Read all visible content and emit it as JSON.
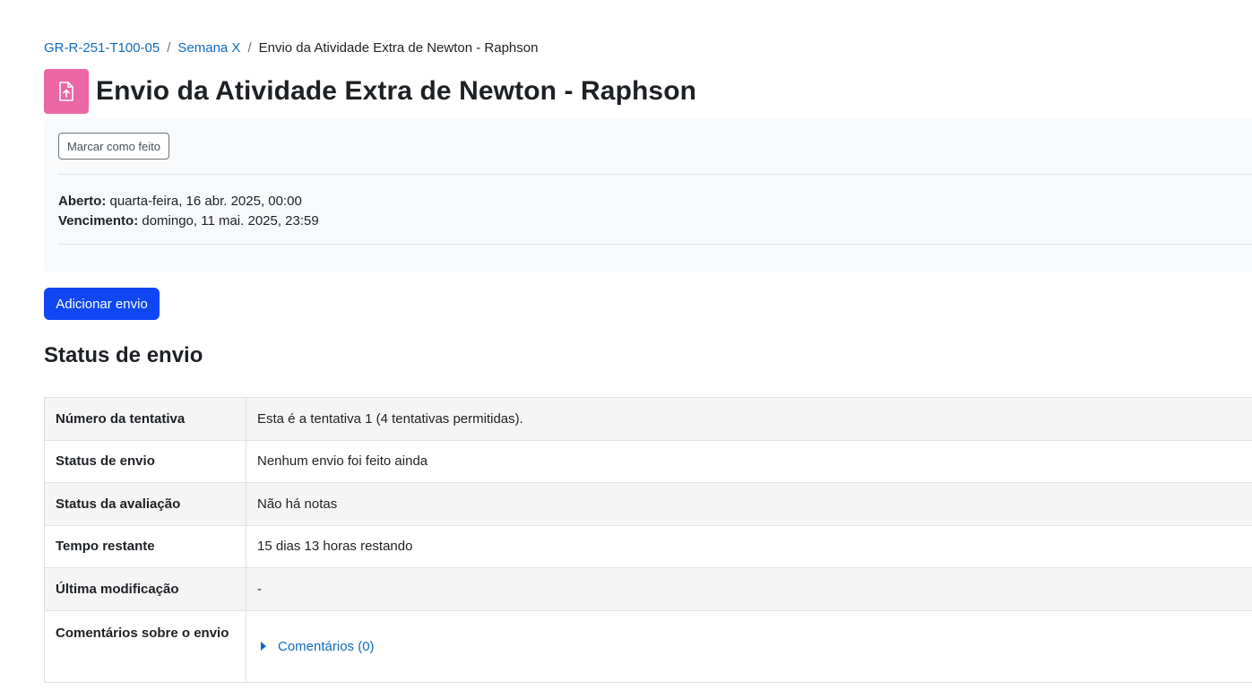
{
  "breadcrumb": {
    "items": [
      "GR-R-251-T100-05",
      "Semana X"
    ],
    "current": "Envio da Atividade Extra de Newton - Raphson",
    "separator": "/"
  },
  "header": {
    "title": "Envio da Atividade Extra de Newton - Raphson",
    "icon": "assignment-upload-icon",
    "icon_color": "#eb66a2"
  },
  "completion": {
    "mark_done_label": "Marcar como feito"
  },
  "dates": {
    "opened_label": "Aberto:",
    "opened_value": "quarta-feira, 16 abr. 2025, 00:00",
    "due_label": "Vencimento:",
    "due_value": "domingo, 11 mai. 2025, 23:59"
  },
  "actions": {
    "add_submission_label": "Adicionar envio",
    "primary_color": "#0f47f5"
  },
  "submission_status": {
    "title": "Status de envio",
    "rows": [
      {
        "label": "Número da tentativa",
        "value": "Esta é a tentativa 1 (4 tentativas permitidas)."
      },
      {
        "label": "Status de envio",
        "value": "Nenhum envio foi feito ainda"
      },
      {
        "label": "Status da avaliação",
        "value": "Não há notas"
      },
      {
        "label": "Tempo restante",
        "value": "15 dias 13 horas restando"
      },
      {
        "label": "Última modificação",
        "value": "-"
      },
      {
        "label": "Comentários sobre o envio",
        "value": "Comentários (0)"
      }
    ]
  }
}
